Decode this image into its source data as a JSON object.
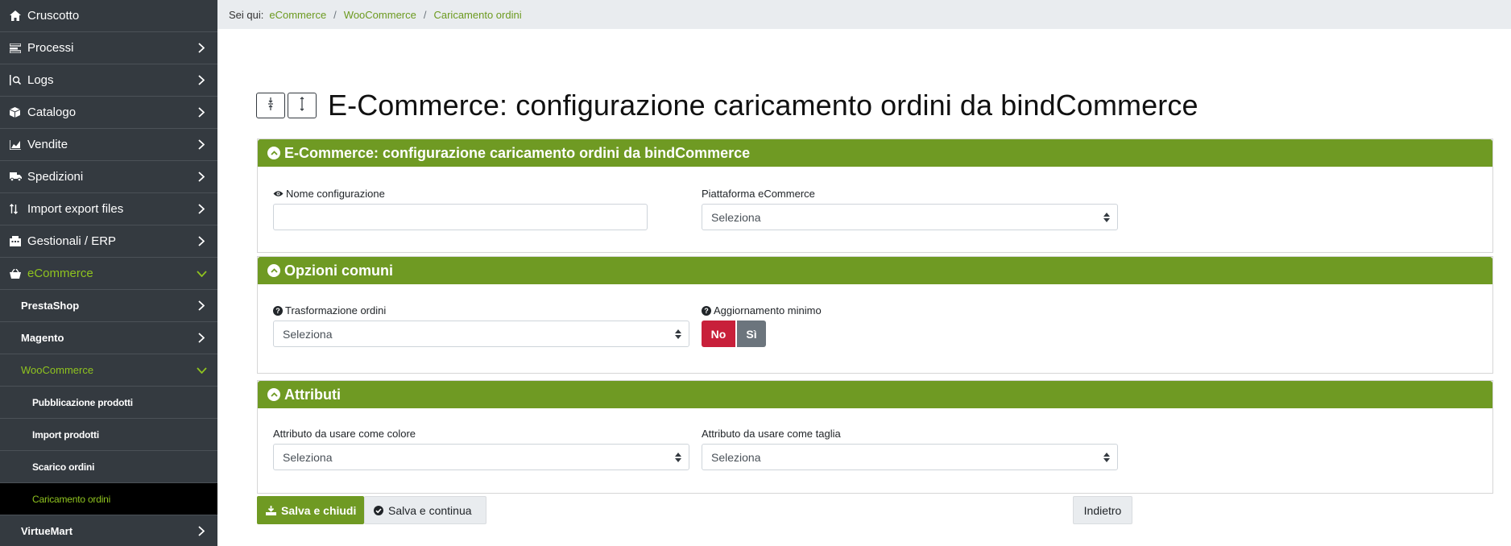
{
  "sidebar": {
    "items": [
      {
        "label": "Cruscotto",
        "icon": "home-icon"
      },
      {
        "label": "Processi",
        "icon": "processes-icon"
      },
      {
        "label": "Logs",
        "icon": "logs-icon"
      },
      {
        "label": "Catalogo",
        "icon": "box-icon"
      },
      {
        "label": "Vendite",
        "icon": "chart-icon"
      },
      {
        "label": "Spedizioni",
        "icon": "truck-icon"
      },
      {
        "label": "Import export files",
        "icon": "sort-icon"
      },
      {
        "label": "Gestionali / ERP",
        "icon": "building-icon"
      },
      {
        "label": "eCommerce",
        "icon": "basket-icon"
      }
    ],
    "sub_items": [
      {
        "label": "PrestaShop"
      },
      {
        "label": "Magento"
      },
      {
        "label": "WooCommerce"
      }
    ],
    "subsub_items": [
      {
        "label": "Pubblicazione prodotti"
      },
      {
        "label": "Import prodotti"
      },
      {
        "label": "Scarico ordini"
      },
      {
        "label": "Caricamento ordini"
      }
    ],
    "after_items": [
      {
        "label": "VirtueMart"
      }
    ]
  },
  "breadcrumb": {
    "prefix": "Sei qui:",
    "items": [
      "eCommerce",
      "WooCommerce",
      "Caricamento ordini"
    ]
  },
  "page": {
    "title": "E-Commerce: configurazione caricamento ordini da bindCommerce"
  },
  "cards": {
    "config": {
      "header": "E-Commerce: configurazione caricamento ordini da bindCommerce",
      "name_label": "Nome configurazione",
      "name_value": "",
      "platform_label": "Piattaforma eCommerce",
      "platform_value": "Seleziona"
    },
    "options": {
      "header": "Opzioni comuni",
      "transform_label": "Trasformazione ordini",
      "transform_value": "Seleziona",
      "min_update_label": "Aggiornamento minimo",
      "toggle_no": "No",
      "toggle_si": "Sì"
    },
    "attributes": {
      "header": "Attributi",
      "color_label": "Attributo da usare come colore",
      "color_value": "Seleziona",
      "size_label": "Attributo da usare come taglia",
      "size_value": "Seleziona"
    }
  },
  "actions": {
    "save_close": "Salva e chiudi",
    "save_continue": "Salva e continua",
    "back": "Indietro"
  },
  "colors": {
    "accent_green": "#6f9a23",
    "active_green": "#8fc31f",
    "sidebar_bg": "#343a40",
    "toggle_no": "#c8203a",
    "toggle_si": "#6c757d"
  }
}
